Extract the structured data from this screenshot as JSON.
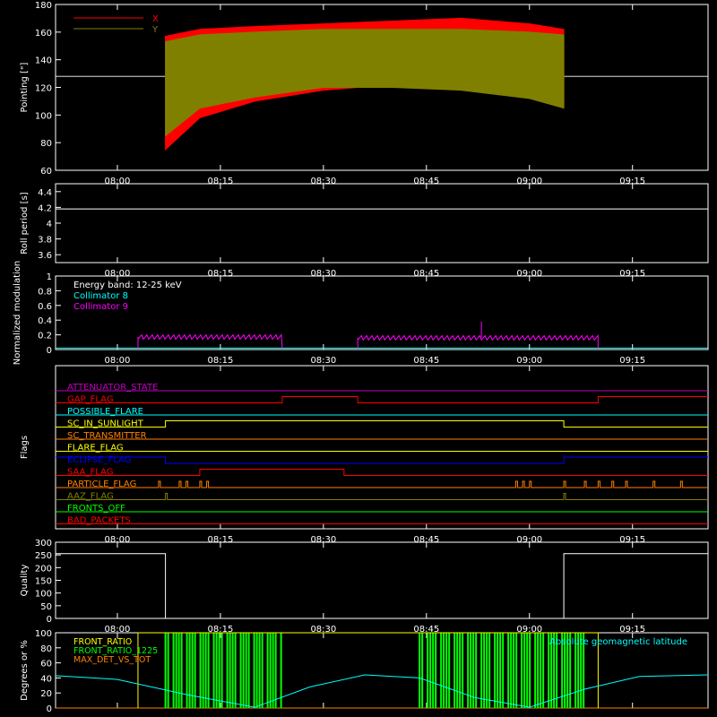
{
  "colors": {
    "background": "#000000",
    "axes": "#ffffff",
    "red": "#ff0000",
    "olive": "#808000",
    "cyan": "#00ffff",
    "magenta": "#ff00ff",
    "green": "#00ff00",
    "yellow": "#ffff00",
    "orange": "#ff8000",
    "blue": "#0000ff",
    "purple": "#c000c0"
  },
  "x_time_ticks": [
    "08:00",
    "08:15",
    "08:30",
    "08:45",
    "09:00",
    "09:15"
  ],
  "chart_data": [
    {
      "id": "pointing",
      "type": "area",
      "ylabel": "Pointing [\"]",
      "xlim": [
        "07:51",
        "09:26"
      ],
      "ylim": [
        60,
        180
      ],
      "yticks": [
        60,
        80,
        100,
        120,
        140,
        160,
        180
      ],
      "legend": "top-left",
      "reference_line": 128,
      "series": [
        {
          "name": "X",
          "color": "#ff0000",
          "x": [
            "08:07",
            "08:12",
            "08:20",
            "08:30",
            "08:40",
            "08:50",
            "09:00",
            "09:05"
          ],
          "upper": [
            157,
            162,
            164,
            166,
            168,
            170,
            166,
            162
          ],
          "lower": [
            75,
            98,
            110,
            118,
            122,
            123,
            120,
            108
          ]
        },
        {
          "name": "Y",
          "color": "#808000",
          "x": [
            "08:07",
            "08:12",
            "08:20",
            "08:30",
            "08:40",
            "08:50",
            "09:00",
            "09:05"
          ],
          "upper": [
            153,
            158,
            160,
            162,
            162,
            162,
            160,
            158
          ],
          "lower": [
            85,
            105,
            113,
            120,
            120,
            118,
            112,
            105
          ]
        }
      ]
    },
    {
      "id": "roll-period",
      "type": "line",
      "ylabel": "Roll period [s]",
      "ylim": [
        3.5,
        4.5
      ],
      "yticks": [
        3.6,
        3.8,
        4.0,
        4.2,
        4.4
      ],
      "series": [
        {
          "x": [
            "07:51",
            "09:26"
          ],
          "values": [
            4.18,
            4.18
          ],
          "color": "#ffffff"
        }
      ]
    },
    {
      "id": "modulation",
      "type": "line",
      "ylabel": "Normalized modulation",
      "ylim": [
        0,
        1
      ],
      "yticks": [
        0.0,
        0.2,
        0.4,
        0.6,
        0.8,
        1.0
      ],
      "legend_title": "Energy band: 12-25 keV",
      "series": [
        {
          "name": "Collimator 8",
          "color": "#00ffff",
          "level": 0.02
        },
        {
          "name": "Collimator 9",
          "color": "#ff00ff",
          "segments": [
            {
              "x0": "08:03",
              "x1": "08:24",
              "level": 0.17
            },
            {
              "x0": "08:35",
              "x1": "09:10",
              "level": 0.16
            }
          ],
          "spike": {
            "x": "08:53",
            "value": 0.38
          }
        }
      ]
    },
    {
      "id": "flags",
      "type": "line",
      "ylabel": "Flags",
      "series": [
        {
          "name": "ATTENUATOR_STATE",
          "color": "#c000c0",
          "transitions": []
        },
        {
          "name": "GAP_FLAG",
          "color": "#ff0000",
          "transitions": [
            "08:24",
            "08:35",
            "09:10"
          ]
        },
        {
          "name": "POSSIBLE_FLARE",
          "color": "#00ffff",
          "transitions": []
        },
        {
          "name": "SC_IN_SUNLIGHT",
          "color": "#ffff00",
          "transitions": [
            "08:07",
            "09:05"
          ]
        },
        {
          "name": "SC_TRANSMITTER",
          "color": "#ff8000",
          "transitions": []
        },
        {
          "name": "FLARE_FLAG",
          "color": "#ffff00",
          "transitions": []
        },
        {
          "name": "ECLIPSE_FLAG",
          "color": "#0000ff",
          "transitions": [
            "08:07",
            "09:05"
          ]
        },
        {
          "name": "SAA_FLAG",
          "color": "#ff0000",
          "transitions": [
            "08:12",
            "08:33"
          ]
        },
        {
          "name": "PARTICLE_FLAG",
          "color": "#ff8000",
          "pulses": [
            "08:06",
            "08:09",
            "08:10",
            "08:12",
            "08:13",
            "08:58",
            "08:59",
            "09:00",
            "09:05",
            "09:08",
            "09:10",
            "09:12",
            "09:14",
            "09:18",
            "09:22"
          ]
        },
        {
          "name": "AAZ_FLAG",
          "color": "#808000",
          "pulses": [
            "08:07",
            "09:05"
          ]
        },
        {
          "name": "FRONTS_OFF",
          "color": "#00ff00",
          "transitions": []
        },
        {
          "name": "BAD_PACKETS",
          "color": "#ff0000",
          "transitions": []
        }
      ]
    },
    {
      "id": "quality",
      "type": "line",
      "ylabel": "Quality",
      "ylim": [
        0,
        300
      ],
      "yticks": [
        0,
        50,
        100,
        150,
        200,
        250,
        300
      ],
      "series": [
        {
          "color": "#ffffff",
          "steps": [
            {
              "x0": "07:51",
              "x1": "08:07",
              "value": 255
            },
            {
              "x0": "08:07",
              "x1": "09:05",
              "value": 0
            },
            {
              "x0": "09:05",
              "x1": "09:26",
              "value": 255
            }
          ]
        }
      ]
    },
    {
      "id": "geomagnetic",
      "type": "line",
      "ylabel": "Degrees or %",
      "ylim": [
        0,
        100
      ],
      "yticks": [
        0,
        20,
        40,
        60,
        80,
        100
      ],
      "series": [
        {
          "name": "FRONT_RATIO",
          "color": "#ffff00",
          "level": 100,
          "x0": "08:03",
          "x1": "09:10"
        },
        {
          "name": "FRONT_RATIO_1225",
          "color": "#00ff00",
          "bursts": [
            [
              "08:07",
              "08:24"
            ],
            [
              "08:44",
              "09:08"
            ]
          ]
        },
        {
          "name": "MAX_DET_VS_TOT",
          "color": "#ff8000",
          "level": 0
        },
        {
          "name": "Absolute geomagnetic latitude",
          "color": "#00ffff",
          "x": [
            "07:51",
            "08:00",
            "08:10",
            "08:20",
            "08:28",
            "08:36",
            "08:44",
            "08:52",
            "09:00",
            "09:08",
            "09:16",
            "09:26"
          ],
          "values": [
            43,
            38,
            18,
            1,
            28,
            44,
            40,
            14,
            1,
            25,
            42,
            44
          ]
        }
      ]
    }
  ]
}
